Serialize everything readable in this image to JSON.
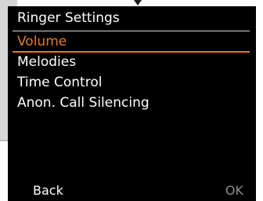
{
  "header": {
    "title": "Ringer Settings"
  },
  "menu": {
    "items": [
      {
        "label": "Volume",
        "selected": true
      },
      {
        "label": "Melodies",
        "selected": false
      },
      {
        "label": "Time Control",
        "selected": false
      },
      {
        "label": "Anon. Call Silencing",
        "selected": false
      }
    ]
  },
  "softkeys": {
    "left_label": "Back",
    "right_label": "OK"
  },
  "colors": {
    "accent": "#e07a2a",
    "background": "#000000",
    "text": "#ffffff",
    "disabled_text": "#8c8c8c"
  }
}
